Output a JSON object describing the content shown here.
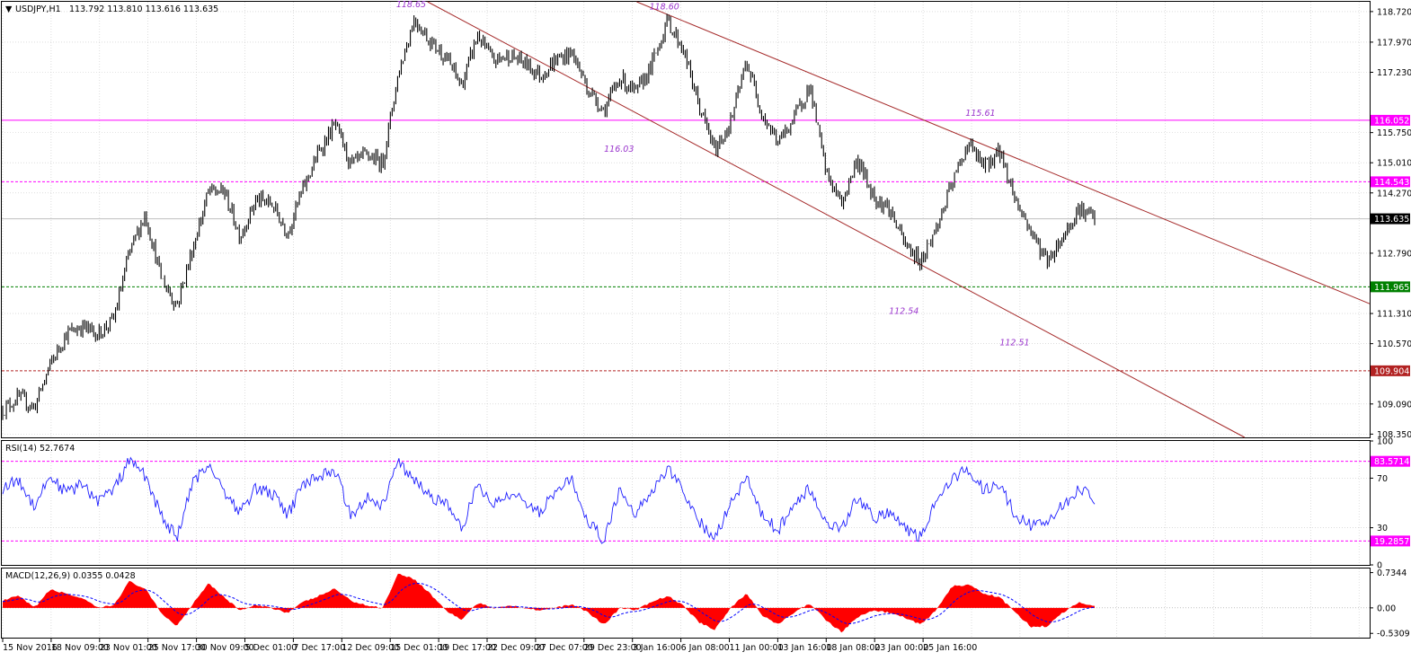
{
  "instrument": {
    "symbol_tf": "USDJPY,H1",
    "ohlc": "113.792 113.810 113.616 113.635",
    "last_price": "113.635"
  },
  "colors": {
    "background": "#ffffff",
    "grid": "#c8c8c8",
    "candle": "#000000",
    "resistance_line": "#ff00ff",
    "support_line": "#008000",
    "target_line": "#b22222",
    "channel": "#a52a2a",
    "annotation": "#9933cc",
    "rsi": "#1e1eff",
    "rsi_levels": "#ff00ff",
    "macd_hist": "#ff0000",
    "macd_signal": "#0000ff"
  },
  "chart_data": [
    {
      "type": "line",
      "title": "USDJPY,H1",
      "y_ticks": [
        "108.350",
        "109.090",
        "110.570",
        "111.310",
        "112.790",
        "114.270",
        "115.010",
        "115.750",
        "117.230",
        "117.970",
        "118.720"
      ],
      "ylim": [
        108.27,
        118.96
      ],
      "x_tick_labels": [
        "15 Nov 2016",
        "18 Nov 09:00",
        "23 Nov 01:00",
        "25 Nov 17:00",
        "30 Nov 09:00",
        "5 Dec 01:00",
        "7 Dec 17:00",
        "12 Dec 09:00",
        "15 Dec 01:00",
        "19 Dec 17:00",
        "22 Dec 09:00",
        "27 Dec 07:00",
        "29 Dec 23:00",
        "3 Jan 16:00",
        "6 Jan 08:00",
        "11 Jan 00:00",
        "13 Jan 16:00",
        "18 Jan 08:00",
        "23 Jan 00:00",
        "25 Jan 16:00"
      ],
      "price_path": [
        {
          "i": 0,
          "v": 108.95
        },
        {
          "i": 1,
          "v": 109.25
        },
        {
          "i": 2,
          "v": 109.0
        },
        {
          "i": 3,
          "v": 110.05
        },
        {
          "i": 4,
          "v": 110.8
        },
        {
          "i": 5,
          "v": 111.0
        },
        {
          "i": 6,
          "v": 110.8
        },
        {
          "i": 7,
          "v": 111.15
        },
        {
          "i": 8,
          "v": 112.8
        },
        {
          "i": 9,
          "v": 113.75
        },
        {
          "i": 10,
          "v": 112.2
        },
        {
          "i": 11,
          "v": 111.5
        },
        {
          "i": 12,
          "v": 112.9
        },
        {
          "i": 13,
          "v": 114.3
        },
        {
          "i": 14,
          "v": 114.3
        },
        {
          "i": 15,
          "v": 113.2
        },
        {
          "i": 16,
          "v": 114.1
        },
        {
          "i": 17,
          "v": 114.0
        },
        {
          "i": 18,
          "v": 113.3
        },
        {
          "i": 19,
          "v": 114.4
        },
        {
          "i": 20,
          "v": 115.3
        },
        {
          "i": 21,
          "v": 115.95
        },
        {
          "i": 22,
          "v": 114.95
        },
        {
          "i": 23,
          "v": 115.2
        },
        {
          "i": 24,
          "v": 115.0
        },
        {
          "i": 25,
          "v": 117.2
        },
        {
          "i": 26,
          "v": 118.55
        },
        {
          "i": 27,
          "v": 118.0
        },
        {
          "i": 28,
          "v": 117.6
        },
        {
          "i": 29,
          "v": 116.9
        },
        {
          "i": 30,
          "v": 118.15
        },
        {
          "i": 31,
          "v": 117.5
        },
        {
          "i": 32,
          "v": 117.65
        },
        {
          "i": 33,
          "v": 117.45
        },
        {
          "i": 34,
          "v": 117.15
        },
        {
          "i": 35,
          "v": 117.55
        },
        {
          "i": 36,
          "v": 117.7
        },
        {
          "i": 37,
          "v": 116.8
        },
        {
          "i": 38,
          "v": 116.3
        },
        {
          "i": 39,
          "v": 117.1
        },
        {
          "i": 40,
          "v": 116.7
        },
        {
          "i": 41,
          "v": 117.4
        },
        {
          "i": 42,
          "v": 118.5
        },
        {
          "i": 43,
          "v": 117.8
        },
        {
          "i": 44,
          "v": 116.4
        },
        {
          "i": 45,
          "v": 115.3
        },
        {
          "i": 46,
          "v": 116.0
        },
        {
          "i": 47,
          "v": 117.5
        },
        {
          "i": 48,
          "v": 116.2
        },
        {
          "i": 49,
          "v": 115.5
        },
        {
          "i": 50,
          "v": 116.1
        },
        {
          "i": 51,
          "v": 116.9
        },
        {
          "i": 52,
          "v": 114.8
        },
        {
          "i": 53,
          "v": 114.0
        },
        {
          "i": 54,
          "v": 115.1
        },
        {
          "i": 55,
          "v": 114.2
        },
        {
          "i": 56,
          "v": 113.9
        },
        {
          "i": 57,
          "v": 113.0
        },
        {
          "i": 58,
          "v": 112.6
        },
        {
          "i": 59,
          "v": 113.4
        },
        {
          "i": 60,
          "v": 114.5
        },
        {
          "i": 61,
          "v": 115.5
        },
        {
          "i": 62,
          "v": 114.9
        },
        {
          "i": 63,
          "v": 115.3
        },
        {
          "i": 64,
          "v": 114.1
        },
        {
          "i": 65,
          "v": 113.3
        },
        {
          "i": 66,
          "v": 112.6
        },
        {
          "i": 67,
          "v": 113.2
        },
        {
          "i": 68,
          "v": 113.9
        },
        {
          "i": 69,
          "v": 113.635
        }
      ],
      "horizontal_levels": [
        {
          "label": "116.052",
          "value": 116.052,
          "style": "solid",
          "color_key": "resistance_line"
        },
        {
          "label": "114.543",
          "value": 114.543,
          "style": "dashed",
          "color_key": "resistance_line"
        },
        {
          "label": "111.965",
          "value": 111.965,
          "style": "dashed",
          "color_key": "support_line"
        },
        {
          "label": "109.904",
          "value": 109.904,
          "style": "dashed",
          "color_key": "target_line"
        }
      ],
      "annotations": [
        {
          "text": "118.65",
          "value": 118.65
        },
        {
          "text": "118.60",
          "value": 118.6
        },
        {
          "text": "116.03",
          "value": 116.03
        },
        {
          "text": "115.61",
          "value": 115.61
        },
        {
          "text": "112.54",
          "value": 112.54
        },
        {
          "text": "112.51",
          "value": 112.51
        }
      ],
      "channel": {
        "upper": [
          {
            "i": 42,
            "v": 118.65
          },
          {
            "i": 61,
            "v": 115.61
          }
        ],
        "lower": [
          {
            "i": 41,
            "v": 116.03
          },
          {
            "i": 58,
            "v": 112.51
          }
        ]
      }
    },
    {
      "type": "line",
      "title": "RSI(14) 52.7674",
      "y_ticks": [
        "100",
        "70",
        "30",
        "0"
      ],
      "ylim": [
        0,
        100
      ],
      "levels": [
        {
          "label": "83.5714",
          "value": 83.5714
        },
        {
          "label": "19.2857",
          "value": 19.2857
        }
      ],
      "rsi_path": [
        {
          "i": 0,
          "v": 62
        },
        {
          "i": 1,
          "v": 68
        },
        {
          "i": 2,
          "v": 48
        },
        {
          "i": 3,
          "v": 72
        },
        {
          "i": 4,
          "v": 58
        },
        {
          "i": 5,
          "v": 65
        },
        {
          "i": 6,
          "v": 52
        },
        {
          "i": 7,
          "v": 60
        },
        {
          "i": 8,
          "v": 84
        },
        {
          "i": 9,
          "v": 72
        },
        {
          "i": 10,
          "v": 40
        },
        {
          "i": 11,
          "v": 22
        },
        {
          "i": 12,
          "v": 65
        },
        {
          "i": 13,
          "v": 82
        },
        {
          "i": 14,
          "v": 60
        },
        {
          "i": 15,
          "v": 42
        },
        {
          "i": 16,
          "v": 62
        },
        {
          "i": 17,
          "v": 58
        },
        {
          "i": 18,
          "v": 40
        },
        {
          "i": 19,
          "v": 65
        },
        {
          "i": 20,
          "v": 72
        },
        {
          "i": 21,
          "v": 76
        },
        {
          "i": 22,
          "v": 40
        },
        {
          "i": 23,
          "v": 55
        },
        {
          "i": 24,
          "v": 48
        },
        {
          "i": 25,
          "v": 83
        },
        {
          "i": 26,
          "v": 68
        },
        {
          "i": 27,
          "v": 55
        },
        {
          "i": 28,
          "v": 50
        },
        {
          "i": 29,
          "v": 28
        },
        {
          "i": 30,
          "v": 65
        },
        {
          "i": 31,
          "v": 48
        },
        {
          "i": 32,
          "v": 58
        },
        {
          "i": 33,
          "v": 52
        },
        {
          "i": 34,
          "v": 42
        },
        {
          "i": 35,
          "v": 62
        },
        {
          "i": 36,
          "v": 68
        },
        {
          "i": 37,
          "v": 35
        },
        {
          "i": 38,
          "v": 20
        },
        {
          "i": 39,
          "v": 60
        },
        {
          "i": 40,
          "v": 42
        },
        {
          "i": 41,
          "v": 60
        },
        {
          "i": 42,
          "v": 78
        },
        {
          "i": 43,
          "v": 60
        },
        {
          "i": 44,
          "v": 35
        },
        {
          "i": 45,
          "v": 22
        },
        {
          "i": 46,
          "v": 50
        },
        {
          "i": 47,
          "v": 70
        },
        {
          "i": 48,
          "v": 40
        },
        {
          "i": 49,
          "v": 28
        },
        {
          "i": 50,
          "v": 48
        },
        {
          "i": 51,
          "v": 62
        },
        {
          "i": 52,
          "v": 35
        },
        {
          "i": 53,
          "v": 28
        },
        {
          "i": 54,
          "v": 55
        },
        {
          "i": 55,
          "v": 38
        },
        {
          "i": 56,
          "v": 42
        },
        {
          "i": 57,
          "v": 30
        },
        {
          "i": 58,
          "v": 22
        },
        {
          "i": 59,
          "v": 55
        },
        {
          "i": 60,
          "v": 68
        },
        {
          "i": 61,
          "v": 78
        },
        {
          "i": 62,
          "v": 60
        },
        {
          "i": 63,
          "v": 64
        },
        {
          "i": 64,
          "v": 40
        },
        {
          "i": 65,
          "v": 32
        },
        {
          "i": 66,
          "v": 35
        },
        {
          "i": 67,
          "v": 48
        },
        {
          "i": 68,
          "v": 62
        },
        {
          "i": 69,
          "v": 52.7674
        }
      ]
    },
    {
      "type": "bar",
      "title": "MACD(12,26,9) 0.0355 0.0428",
      "y_ticks": [
        "0.7344",
        "0.00",
        "-0.5309"
      ],
      "ylim": [
        -0.62,
        0.82
      ],
      "macd_path": [
        {
          "i": 0,
          "v": 0.15
        },
        {
          "i": 1,
          "v": 0.25
        },
        {
          "i": 2,
          "v": 0.0
        },
        {
          "i": 3,
          "v": 0.38
        },
        {
          "i": 4,
          "v": 0.3
        },
        {
          "i": 5,
          "v": 0.2
        },
        {
          "i": 6,
          "v": 0.0
        },
        {
          "i": 7,
          "v": 0.05
        },
        {
          "i": 8,
          "v": 0.55
        },
        {
          "i": 9,
          "v": 0.4
        },
        {
          "i": 10,
          "v": -0.1
        },
        {
          "i": 11,
          "v": -0.38
        },
        {
          "i": 12,
          "v": 0.08
        },
        {
          "i": 13,
          "v": 0.52
        },
        {
          "i": 14,
          "v": 0.22
        },
        {
          "i": 15,
          "v": -0.05
        },
        {
          "i": 16,
          "v": 0.05
        },
        {
          "i": 17,
          "v": 0.0
        },
        {
          "i": 18,
          "v": -0.1
        },
        {
          "i": 19,
          "v": 0.12
        },
        {
          "i": 20,
          "v": 0.25
        },
        {
          "i": 21,
          "v": 0.4
        },
        {
          "i": 22,
          "v": 0.15
        },
        {
          "i": 23,
          "v": 0.05
        },
        {
          "i": 24,
          "v": 0.0
        },
        {
          "i": 25,
          "v": 0.72
        },
        {
          "i": 26,
          "v": 0.6
        },
        {
          "i": 27,
          "v": 0.3
        },
        {
          "i": 28,
          "v": -0.05
        },
        {
          "i": 29,
          "v": -0.25
        },
        {
          "i": 30,
          "v": 0.1
        },
        {
          "i": 31,
          "v": 0.0
        },
        {
          "i": 32,
          "v": 0.05
        },
        {
          "i": 33,
          "v": 0.0
        },
        {
          "i": 34,
          "v": -0.05
        },
        {
          "i": 35,
          "v": 0.0
        },
        {
          "i": 36,
          "v": 0.08
        },
        {
          "i": 37,
          "v": -0.1
        },
        {
          "i": 38,
          "v": -0.35
        },
        {
          "i": 39,
          "v": 0.0
        },
        {
          "i": 40,
          "v": -0.05
        },
        {
          "i": 41,
          "v": 0.12
        },
        {
          "i": 42,
          "v": 0.25
        },
        {
          "i": 43,
          "v": 0.05
        },
        {
          "i": 44,
          "v": -0.3
        },
        {
          "i": 45,
          "v": -0.45
        },
        {
          "i": 46,
          "v": 0.0
        },
        {
          "i": 47,
          "v": 0.3
        },
        {
          "i": 48,
          "v": -0.15
        },
        {
          "i": 49,
          "v": -0.35
        },
        {
          "i": 50,
          "v": -0.1
        },
        {
          "i": 51,
          "v": 0.1
        },
        {
          "i": 52,
          "v": -0.25
        },
        {
          "i": 53,
          "v": -0.5
        },
        {
          "i": 54,
          "v": -0.2
        },
        {
          "i": 55,
          "v": -0.05
        },
        {
          "i": 56,
          "v": -0.1
        },
        {
          "i": 57,
          "v": -0.2
        },
        {
          "i": 58,
          "v": -0.35
        },
        {
          "i": 59,
          "v": -0.05
        },
        {
          "i": 60,
          "v": 0.45
        },
        {
          "i": 61,
          "v": 0.48
        },
        {
          "i": 62,
          "v": 0.3
        },
        {
          "i": 63,
          "v": 0.22
        },
        {
          "i": 64,
          "v": -0.1
        },
        {
          "i": 65,
          "v": -0.4
        },
        {
          "i": 66,
          "v": -0.38
        },
        {
          "i": 67,
          "v": -0.1
        },
        {
          "i": 68,
          "v": 0.12
        },
        {
          "i": 69,
          "v": 0.0355
        }
      ]
    }
  ]
}
